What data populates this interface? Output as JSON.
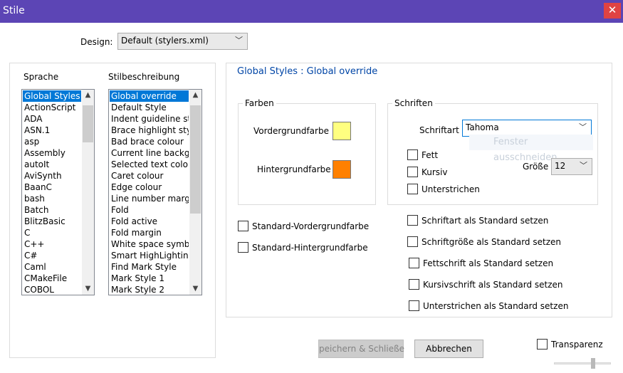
{
  "window": {
    "title": "Stile",
    "close_glyph": "✕"
  },
  "design": {
    "label": "Design:",
    "value": "Default (stylers.xml)"
  },
  "lists": {
    "sprache_header": "Sprache",
    "stil_header": "Stilbeschreibung",
    "sprache": [
      "Global Styles",
      "ActionScript",
      "ADA",
      "ASN.1",
      "asp",
      "Assembly",
      "autoIt",
      "AviSynth",
      "BaanC",
      "bash",
      "Batch",
      "BlitzBasic",
      "C",
      "C++",
      "C#",
      "Caml",
      "CMakeFile",
      "COBOL"
    ],
    "stil": [
      "Global override",
      "Default Style",
      "Indent guideline style",
      "Brace highlight style",
      "Bad brace colour",
      "Current line background",
      "Selected text colour",
      "Caret colour",
      "Edge colour",
      "Line number margin",
      "Fold",
      "Fold active",
      "Fold margin",
      "White space symbol",
      "Smart HighLighting",
      "Find Mark Style",
      "Mark Style 1",
      "Mark Style 2"
    ],
    "sprache_selected": "Global Styles",
    "stil_selected": "Global override"
  },
  "panel": {
    "heading": "Global Styles : Global override"
  },
  "farben": {
    "title": "Farben",
    "fg_label": "Vordergrundfarbe",
    "bg_label": "Hintergrundfarbe",
    "fg_color": "#ffff80",
    "bg_color": "#ff8000"
  },
  "schriften": {
    "title": "Schriften",
    "font_label": "Schriftart",
    "font_value": "Tahoma",
    "bold": "Fett",
    "italic": "Kursiv",
    "underline": "Unterstrichen",
    "size_label": "Größe",
    "size_value": "12"
  },
  "tooltip_ghost": "Fenster ausschneiden",
  "checkboxes": {
    "std_fg": "Standard-Vordergrundfarbe",
    "std_bg": "Standard-Hintergrundfarbe",
    "font_std": "Schriftart als Standard setzen",
    "size_std": "Schriftgröße als Standard setzen",
    "bold_std": "Fettschrift als Standard setzen",
    "italic_std": "Kursivschrift als Standard setzen",
    "underline_std": "Unterstrichen als Standard setzen"
  },
  "buttons": {
    "save_close": "peichern & Schließe",
    "cancel": "Abbrechen"
  },
  "transparency": {
    "label": "Transparenz",
    "level": 0.7
  },
  "colors": {
    "titlebar": "#5c45b5",
    "accent": "#0078d7",
    "heading": "#0045a6"
  }
}
